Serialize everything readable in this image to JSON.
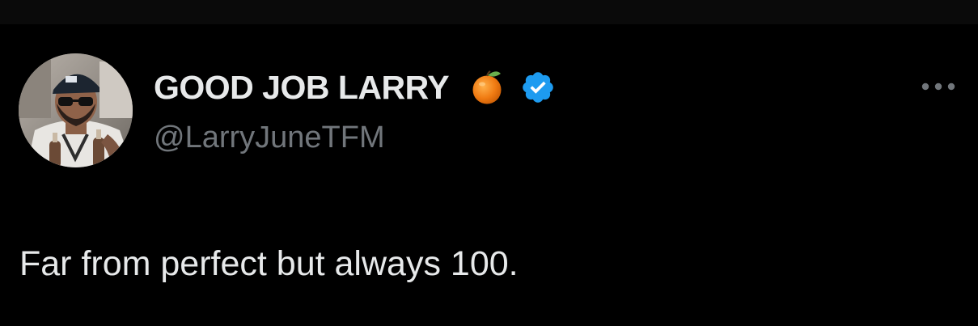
{
  "tweet": {
    "author": {
      "display_name": "GOOD JOB LARRY",
      "handle": "@LarryJuneTFM",
      "avatar_icon": "avatar-photo",
      "name_emoji": "orange-emoji-icon",
      "verified_icon": "verified-badge-icon",
      "verified_color": "#1d9bf0"
    },
    "text": "Far from perfect but always 100.",
    "more_menu_icon": "more-options-icon"
  },
  "colors": {
    "background": "#000000",
    "primary_text": "#e7e9ea",
    "secondary_text": "#71767b",
    "accent": "#1d9bf0"
  }
}
